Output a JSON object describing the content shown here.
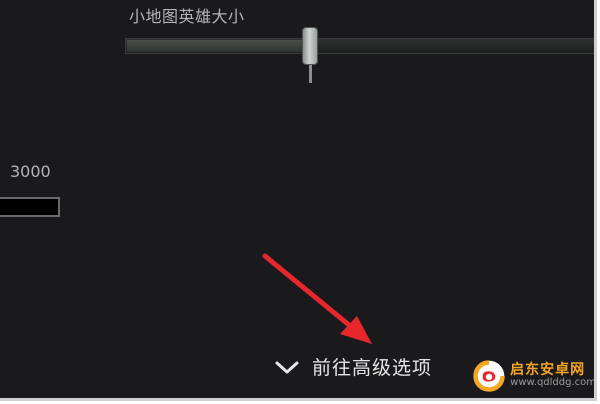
{
  "minimap_slider": {
    "label": "小地图英雄大小",
    "value_fraction": 0.38
  },
  "left_setting": {
    "value_text": "3000"
  },
  "advanced": {
    "label": "前往高级选项",
    "chevron_icon": "chevron-down-icon"
  },
  "annotation": {
    "arrow_color": "#e8262d"
  },
  "watermark": {
    "main_text": "启东安卓网",
    "sub_text": "www.qdlddg.com",
    "accent_color": "#f5a623"
  },
  "colors": {
    "background": "#1a1a1d",
    "label_text": "#b4b4b4",
    "button_text": "#e6e6e6"
  }
}
